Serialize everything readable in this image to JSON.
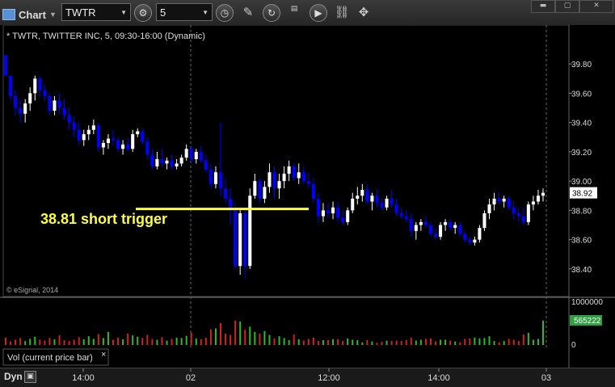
{
  "toolbar": {
    "app_title": "Chart",
    "symbol": "TWTR",
    "interval": "5",
    "icons": [
      "menu-dropdown-icon",
      "settings-gear-icon",
      "clock-icon",
      "draw-pencil-icon",
      "refresh-icon",
      "symbol-info-icon",
      "play-icon",
      "link-icon"
    ],
    "window_buttons": [
      "minimize",
      "maximize",
      "close"
    ]
  },
  "chart_header": "* TWTR, TWITTER INC, 5, 09:30-16:00 (Dynamic)",
  "watermark": "© eSignal, 2014",
  "annotation": {
    "text": "38.81 short trigger",
    "price": 38.81,
    "color": "#ffff33"
  },
  "volume_panel": {
    "label": "Vol (current price bar)",
    "close_label": "×",
    "ticks": [
      "1000000",
      "0"
    ],
    "current_value": "565222"
  },
  "footer": {
    "label": "Dyn"
  },
  "colors": {
    "up": "#ffffff",
    "down": "#0000ff",
    "vol_up": "#2db82d",
    "vol_down": "#d42020",
    "grid": "#555555",
    "price_label_bg": "#ffffff",
    "vol_label_bg": "#2ea043"
  },
  "chart_data": {
    "type": "candlestick",
    "symbol": "TWTR",
    "ylim": [
      38.3,
      39.9
    ],
    "ytick_labels": [
      "39.80",
      "39.60",
      "39.40",
      "39.20",
      "39.00",
      "38.80",
      "38.60",
      "38.40"
    ],
    "x_tick_labels": [
      "14:00",
      "02",
      "12:00",
      "14:00",
      "03"
    ],
    "last_price_label": "38.92",
    "reference_line": 38.81,
    "candles": [
      [
        39.86,
        39.85,
        39.72,
        39.72
      ],
      [
        39.72,
        39.68,
        39.55,
        39.58
      ],
      [
        39.58,
        39.62,
        39.45,
        39.5
      ],
      [
        39.5,
        39.55,
        39.4,
        39.46
      ],
      [
        39.46,
        39.56,
        39.4,
        39.53
      ],
      [
        39.53,
        39.64,
        39.48,
        39.6
      ],
      [
        39.6,
        39.72,
        39.55,
        39.7
      ],
      [
        39.7,
        39.72,
        39.58,
        39.62
      ],
      [
        39.62,
        39.66,
        39.55,
        39.58
      ],
      [
        39.58,
        39.6,
        39.45,
        39.48
      ],
      [
        39.48,
        39.58,
        39.45,
        39.55
      ],
      [
        39.55,
        39.6,
        39.46,
        39.5
      ],
      [
        39.5,
        39.56,
        39.42,
        39.45
      ],
      [
        39.45,
        39.5,
        39.35,
        39.4
      ],
      [
        39.4,
        39.44,
        39.3,
        39.35
      ],
      [
        39.35,
        39.4,
        39.25,
        39.28
      ],
      [
        39.28,
        39.35,
        39.24,
        39.32
      ],
      [
        39.32,
        39.38,
        39.28,
        39.35
      ],
      [
        39.35,
        39.42,
        39.32,
        39.38
      ],
      [
        39.38,
        39.4,
        39.2,
        39.23
      ],
      [
        39.23,
        39.28,
        39.18,
        39.26
      ],
      [
        39.26,
        39.32,
        39.22,
        39.29
      ],
      [
        39.29,
        39.35,
        39.24,
        39.28
      ],
      [
        39.28,
        39.3,
        39.2,
        39.22
      ],
      [
        39.22,
        39.28,
        39.18,
        39.25
      ],
      [
        39.25,
        39.3,
        39.2,
        39.22
      ],
      [
        39.22,
        39.35,
        39.2,
        39.32
      ],
      [
        39.32,
        39.36,
        39.3,
        39.34
      ],
      [
        39.34,
        39.36,
        39.25,
        39.27
      ],
      [
        39.27,
        39.3,
        39.15,
        39.18
      ],
      [
        39.18,
        39.22,
        39.08,
        39.1
      ],
      [
        39.1,
        39.2,
        39.08,
        39.15
      ],
      [
        39.15,
        39.22,
        39.1,
        39.12
      ],
      [
        39.12,
        39.16,
        39.08,
        39.14
      ],
      [
        39.14,
        39.18,
        39.08,
        39.1
      ],
      [
        39.1,
        39.15,
        39.08,
        39.12
      ],
      [
        39.12,
        39.18,
        39.1,
        39.16
      ],
      [
        39.16,
        39.25,
        39.14,
        39.22
      ],
      [
        39.22,
        39.24,
        39.12,
        39.15
      ],
      [
        39.15,
        39.22,
        39.12,
        39.2
      ],
      [
        39.2,
        39.24,
        39.12,
        39.14
      ],
      [
        39.14,
        39.18,
        39.06,
        39.08
      ],
      [
        39.08,
        39.12,
        38.95,
        38.98
      ],
      [
        38.98,
        39.1,
        38.95,
        39.06
      ],
      [
        39.06,
        39.4,
        38.9,
        38.95
      ],
      [
        38.95,
        39.02,
        38.85,
        38.88
      ],
      [
        38.88,
        38.95,
        38.7,
        38.8
      ],
      [
        38.8,
        38.85,
        38.4,
        38.42
      ],
      [
        38.42,
        38.8,
        38.36,
        38.78
      ],
      [
        38.78,
        38.82,
        38.34,
        38.42
      ],
      [
        38.42,
        38.95,
        38.4,
        38.9
      ],
      [
        38.9,
        39.05,
        38.88,
        39.0
      ],
      [
        39.0,
        39.02,
        38.85,
        38.88
      ],
      [
        38.88,
        39.0,
        38.85,
        38.96
      ],
      [
        38.96,
        39.12,
        38.92,
        39.06
      ],
      [
        39.06,
        39.1,
        38.88,
        38.95
      ],
      [
        38.95,
        39.05,
        38.88,
        39.0
      ],
      [
        39.0,
        39.1,
        38.95,
        39.05
      ],
      [
        39.05,
        39.14,
        39.0,
        39.1
      ],
      [
        39.1,
        39.12,
        39.0,
        39.02
      ],
      [
        39.02,
        39.12,
        38.98,
        39.06
      ],
      [
        39.06,
        39.1,
        38.98,
        39.0
      ],
      [
        39.0,
        39.06,
        38.95,
        38.98
      ],
      [
        38.98,
        39.02,
        38.85,
        38.88
      ],
      [
        38.88,
        38.92,
        38.72,
        38.76
      ],
      [
        38.76,
        38.85,
        38.72,
        38.8
      ],
      [
        38.8,
        38.85,
        38.75,
        38.78
      ],
      [
        38.78,
        38.86,
        38.74,
        38.82
      ],
      [
        38.82,
        38.86,
        38.72,
        38.75
      ],
      [
        38.75,
        38.8,
        38.7,
        38.72
      ],
      [
        38.72,
        38.82,
        38.7,
        38.8
      ],
      [
        38.8,
        38.92,
        38.78,
        38.88
      ],
      [
        38.88,
        38.96,
        38.84,
        38.9
      ],
      [
        38.9,
        38.98,
        38.86,
        38.94
      ],
      [
        38.94,
        38.98,
        38.84,
        38.86
      ],
      [
        38.86,
        38.92,
        38.8,
        38.9
      ],
      [
        38.9,
        38.94,
        38.82,
        38.85
      ],
      [
        38.85,
        38.88,
        38.8,
        38.82
      ],
      [
        38.82,
        38.9,
        38.8,
        38.88
      ],
      [
        38.88,
        38.94,
        38.82,
        38.84
      ],
      [
        38.84,
        38.88,
        38.76,
        38.78
      ],
      [
        38.78,
        38.82,
        38.74,
        38.76
      ],
      [
        38.76,
        38.8,
        38.72,
        38.74
      ],
      [
        38.74,
        38.78,
        38.62,
        38.66
      ],
      [
        38.66,
        38.72,
        38.6,
        38.7
      ],
      [
        38.7,
        38.74,
        38.66,
        38.72
      ],
      [
        38.72,
        38.76,
        38.68,
        38.7
      ],
      [
        38.7,
        38.72,
        38.62,
        38.64
      ],
      [
        38.64,
        38.68,
        38.6,
        38.62
      ],
      [
        38.62,
        38.72,
        38.6,
        38.7
      ],
      [
        38.7,
        38.74,
        38.66,
        38.72
      ],
      [
        38.72,
        38.74,
        38.66,
        38.68
      ],
      [
        38.68,
        38.72,
        38.64,
        38.7
      ],
      [
        38.7,
        38.72,
        38.62,
        38.64
      ],
      [
        38.64,
        38.66,
        38.58,
        38.6
      ],
      [
        38.6,
        38.62,
        38.56,
        38.58
      ],
      [
        38.58,
        38.62,
        38.56,
        38.6
      ],
      [
        38.6,
        38.7,
        38.58,
        38.68
      ],
      [
        38.68,
        38.8,
        38.66,
        38.78
      ],
      [
        38.78,
        38.88,
        38.74,
        38.84
      ],
      [
        38.84,
        38.92,
        38.8,
        38.88
      ],
      [
        38.88,
        38.92,
        38.84,
        38.86
      ],
      [
        38.86,
        38.9,
        38.82,
        38.88
      ],
      [
        38.88,
        38.9,
        38.8,
        38.82
      ],
      [
        38.82,
        38.86,
        38.74,
        38.78
      ],
      [
        38.78,
        38.82,
        38.72,
        38.76
      ],
      [
        38.76,
        38.82,
        38.7,
        38.72
      ],
      [
        38.72,
        38.86,
        38.7,
        38.84
      ],
      [
        38.84,
        38.9,
        38.8,
        38.86
      ],
      [
        38.86,
        38.94,
        38.84,
        38.9
      ],
      [
        38.9,
        38.95,
        38.86,
        38.92
      ]
    ],
    "volume_ylim": [
      0,
      1000000
    ],
    "volume": [
      170000,
      80000,
      120000,
      160000,
      90000,
      140000,
      190000,
      120000,
      100000,
      160000,
      130000,
      220000,
      110000,
      90000,
      120000,
      180000,
      130000,
      200000,
      140000,
      250000,
      160000,
      300000,
      120000,
      170000,
      130000,
      260000,
      220000,
      190000,
      160000,
      230000,
      140000,
      120000,
      180000,
      100000,
      140000,
      170000,
      160000,
      210000,
      280000,
      150000,
      130000,
      170000,
      360000,
      380000,
      500000,
      260000,
      230000,
      560000,
      540000,
      350000,
      420000,
      300000,
      260000,
      320000,
      230000,
      150000,
      200000,
      160000,
      110000,
      240000,
      130000,
      100000,
      140000,
      170000,
      90000,
      110000,
      110000,
      130000,
      130000,
      90000,
      150000,
      120000,
      110000,
      60000,
      110000,
      80000,
      50000,
      70000,
      100000,
      90000,
      100000,
      90000,
      110000,
      170000,
      100000,
      120000,
      140000,
      150000,
      80000,
      120000,
      120000,
      100000,
      80000,
      60000,
      140000,
      150000,
      170000,
      150000,
      160000,
      200000,
      90000,
      60000,
      90000,
      140000,
      120000,
      90000,
      240000,
      280000,
      120000,
      140000,
      560000
    ],
    "volume_colors": [
      "down",
      "down",
      "down",
      "down",
      "up",
      "up",
      "up",
      "down",
      "down",
      "down",
      "up",
      "down",
      "down",
      "down",
      "down",
      "down",
      "up",
      "up",
      "up",
      "down",
      "up",
      "up",
      "down",
      "down",
      "up",
      "down",
      "up",
      "up",
      "down",
      "down",
      "down",
      "up",
      "down",
      "up",
      "down",
      "up",
      "up",
      "up",
      "down",
      "up",
      "down",
      "down",
      "down",
      "up",
      "down",
      "down",
      "down",
      "down",
      "up",
      "down",
      "up",
      "up",
      "down",
      "up",
      "up",
      "down",
      "up",
      "up",
      "up",
      "down",
      "up",
      "down",
      "down",
      "down",
      "down",
      "up",
      "down",
      "up",
      "down",
      "down",
      "up",
      "up",
      "up",
      "up",
      "down",
      "up",
      "down",
      "down",
      "up",
      "down",
      "down",
      "down",
      "down",
      "down",
      "up",
      "up",
      "down",
      "down",
      "down",
      "up",
      "up",
      "down",
      "up",
      "down",
      "down",
      "down",
      "up",
      "up",
      "up",
      "up",
      "up",
      "down",
      "up",
      "down",
      "down",
      "down",
      "down",
      "up",
      "up",
      "up",
      "up"
    ]
  }
}
